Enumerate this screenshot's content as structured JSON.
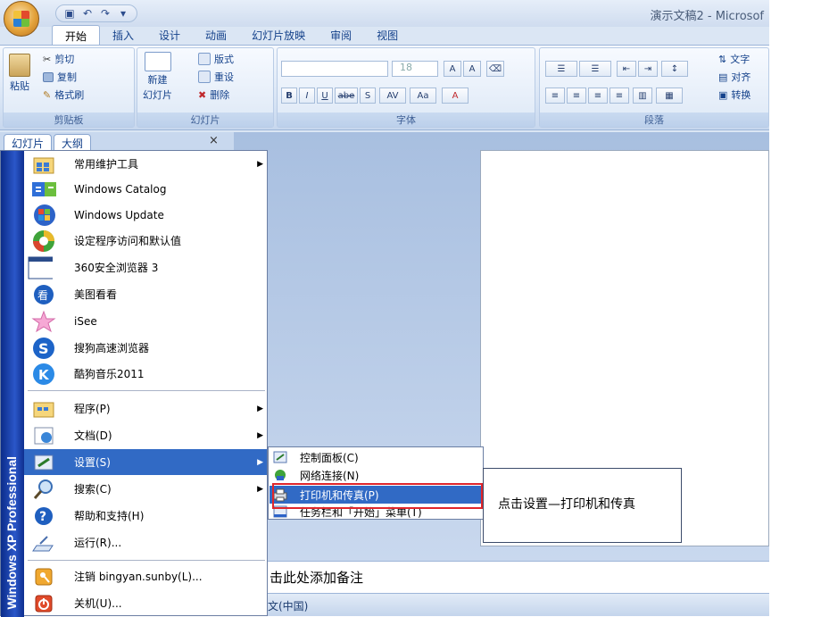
{
  "ppt": {
    "doc_title": "演示文稿2 - Microsof",
    "tabs": [
      "开始",
      "插入",
      "设计",
      "动画",
      "幻灯片放映",
      "审阅",
      "视图"
    ],
    "clipboard": {
      "paste": "粘贴",
      "cut": "剪切",
      "copy": "复制",
      "format_painter": "格式刷",
      "label": "剪贴板"
    },
    "slides": {
      "new_slide": "新建",
      "new_slide2": "幻灯片",
      "layout": "版式",
      "reset": "重设",
      "delete": "删除",
      "label": "幻灯片"
    },
    "font": {
      "size": "18",
      "label": "字体",
      "bold": "B",
      "italic": "I",
      "underline": "U",
      "strike": "abe",
      "shadow": "S",
      "spacing": "AV",
      "case": "Aa",
      "color": "A"
    },
    "paragraph": {
      "label": "段落",
      "text_dir": "文字",
      "align": "对齐",
      "convert": "转换"
    },
    "pane_tabs": [
      "幻灯片",
      "大纲"
    ],
    "pane_close": "×",
    "notes": "击此处添加备注",
    "status_lang": "文(中国)"
  },
  "start_menu": {
    "banner": "Windows XP Professional",
    "items": [
      {
        "label": "常用维护工具",
        "icon": "tools-folder-icon",
        "arrow": true
      },
      {
        "label": "Windows Catalog",
        "icon": "windows-catalog-icon",
        "arrow": false
      },
      {
        "label": "Windows Update",
        "icon": "windows-update-icon",
        "arrow": false
      },
      {
        "label": "设定程序访问和默认值",
        "icon": "program-access-icon",
        "arrow": false
      },
      {
        "label": "360安全浏览器 3",
        "icon": "browser-window-icon",
        "arrow": false
      },
      {
        "label": "美图看看",
        "icon": "meitu-viewer-icon",
        "arrow": false
      },
      {
        "label": "iSee",
        "icon": "isee-star-icon",
        "arrow": false
      },
      {
        "label": "搜狗高速浏览器",
        "icon": "sogou-browser-icon",
        "arrow": false
      },
      {
        "label": "酷狗音乐2011",
        "icon": "kugou-music-icon",
        "arrow": false
      },
      {
        "label": "程序(P)",
        "icon": "programs-icon",
        "arrow": true
      },
      {
        "label": "文档(D)",
        "icon": "documents-icon",
        "arrow": true
      },
      {
        "label": "设置(S)",
        "icon": "settings-icon",
        "arrow": true
      },
      {
        "label": "搜索(C)",
        "icon": "search-icon",
        "arrow": true
      },
      {
        "label": "帮助和支持(H)",
        "icon": "help-icon",
        "arrow": false
      },
      {
        "label": "运行(R)...",
        "icon": "run-icon",
        "arrow": false
      },
      {
        "label": "注销 bingyan.sunby(L)...",
        "icon": "logoff-icon",
        "arrow": false
      },
      {
        "label": "关机(U)...",
        "icon": "shutdown-icon",
        "arrow": false
      }
    ]
  },
  "submenu": {
    "items": [
      {
        "label": "控制面板(C)",
        "icon": "control-panel-icon"
      },
      {
        "label": "网络连接(N)",
        "icon": "network-icon"
      },
      {
        "label": "打印机和传真(P)",
        "icon": "printer-icon"
      },
      {
        "label": "任务栏和「开始」菜单(T)",
        "icon": "taskbar-icon"
      }
    ]
  },
  "callout": {
    "text": "点击设置—打印机和传真"
  },
  "colors": {
    "highlight": "#316ac5",
    "red_box": "#e0262b",
    "xp_blue": "#0b2c8a"
  }
}
